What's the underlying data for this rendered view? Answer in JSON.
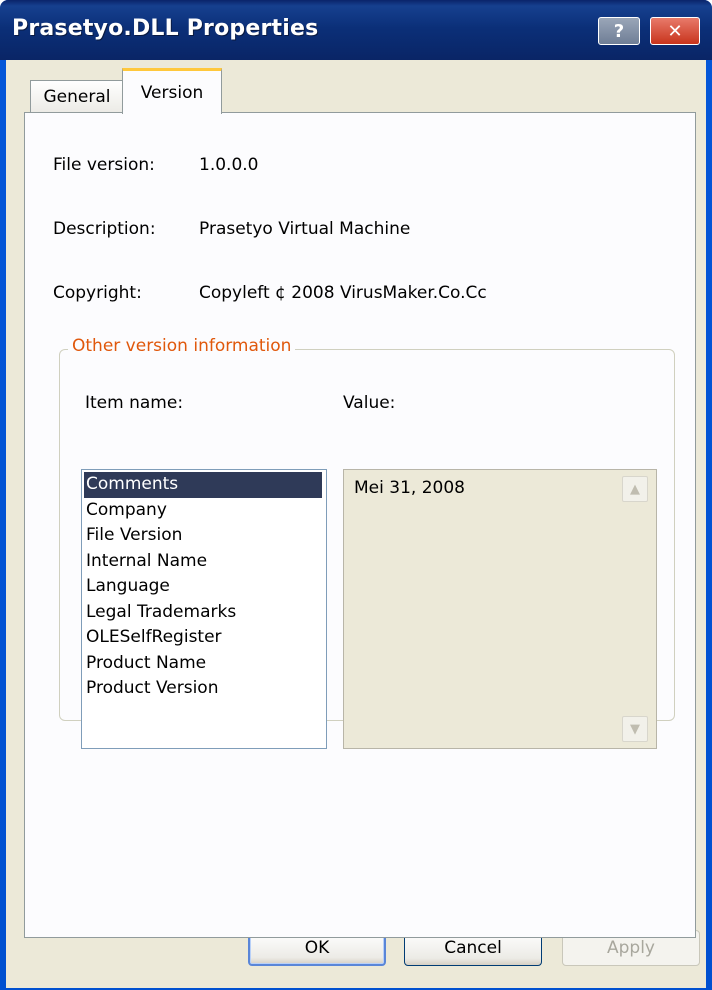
{
  "window": {
    "title": "Prasetyo.DLL Properties",
    "help_label": "?",
    "close_label": "✕"
  },
  "tabs": [
    {
      "label": "General",
      "active": false
    },
    {
      "label": "Version",
      "active": true
    }
  ],
  "version_info": {
    "file_version_label": "File version:",
    "file_version_value": "1.0.0.0",
    "description_label": "Description:",
    "description_value": "Prasetyo Virtual Machine",
    "copyright_label": "Copyright:",
    "copyright_value": "Copyleft ¢ 2008 VirusMaker.Co.Cc"
  },
  "other_info": {
    "group_title": "Other version information",
    "item_name_label": "Item name:",
    "value_label": "Value:",
    "items": [
      "Comments",
      "Company",
      "File Version",
      "Internal Name",
      "Language",
      "Legal Trademarks",
      "OLESelfRegister",
      "Product Name",
      "Product Version"
    ],
    "selected_index": 0,
    "selected_value": "Mei 31, 2008"
  },
  "buttons": {
    "ok": "OK",
    "cancel": "Cancel",
    "apply": "Apply"
  },
  "colors": {
    "title_bar": "#0a246a",
    "group_title": "#e0580c",
    "selection": "#2f3a58",
    "tab_highlight": "#ffc83c"
  }
}
